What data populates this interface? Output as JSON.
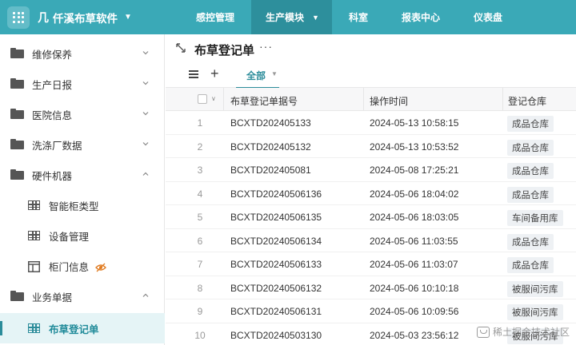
{
  "app": {
    "logo": "几",
    "name": "仟溪布草软件",
    "grid_icon": "apps-grid-icon"
  },
  "nav": {
    "items": [
      {
        "label": "感控管理",
        "active": false
      },
      {
        "label": "生产模块",
        "active": true
      },
      {
        "label": "科室",
        "active": false
      },
      {
        "label": "报表中心",
        "active": false
      },
      {
        "label": "仪表盘",
        "active": false
      }
    ]
  },
  "sidebar": {
    "items": [
      {
        "label": "维修保养",
        "icon": "folder-icon",
        "expanded": false
      },
      {
        "label": "生产日报",
        "icon": "folder-icon",
        "expanded": false
      },
      {
        "label": "医院信息",
        "icon": "folder-icon",
        "expanded": false
      },
      {
        "label": "洗涤厂数据",
        "icon": "folder-icon",
        "expanded": false
      },
      {
        "label": "硬件机器",
        "icon": "folder-icon",
        "expanded": true
      },
      {
        "label": "智能柜类型",
        "icon": "table-icon"
      },
      {
        "label": "设备管理",
        "icon": "table-icon"
      },
      {
        "label": "柜门信息",
        "icon": "cabinet-door-icon",
        "badge_icon": "eye-off-icon"
      },
      {
        "label": "业务单据",
        "icon": "folder-icon",
        "expanded": true
      },
      {
        "label": "布草登记单",
        "icon": "table-icon",
        "active": true
      }
    ]
  },
  "page": {
    "title": "布草登记单",
    "more": "···"
  },
  "toolbar": {
    "tab_all": "全部"
  },
  "table": {
    "columns": [
      "布草登记单据号",
      "操作时间",
      "登记仓库"
    ],
    "rows": [
      {
        "index": "1",
        "code": "BCXTD202405133",
        "time": "2024-05-13 10:58:15",
        "warehouse": "成品仓库"
      },
      {
        "index": "2",
        "code": "BCXTD202405132",
        "time": "2024-05-13 10:53:52",
        "warehouse": "成品仓库"
      },
      {
        "index": "3",
        "code": "BCXTD202405081",
        "time": "2024-05-08 17:25:21",
        "warehouse": "成品仓库"
      },
      {
        "index": "4",
        "code": "BCXTD20240506136",
        "time": "2024-05-06 18:04:02",
        "warehouse": "成品仓库"
      },
      {
        "index": "5",
        "code": "BCXTD20240506135",
        "time": "2024-05-06 18:03:05",
        "warehouse": "车间备用库"
      },
      {
        "index": "6",
        "code": "BCXTD20240506134",
        "time": "2024-05-06 11:03:55",
        "warehouse": "成品仓库"
      },
      {
        "index": "7",
        "code": "BCXTD20240506133",
        "time": "2024-05-06 11:03:07",
        "warehouse": "成品仓库"
      },
      {
        "index": "8",
        "code": "BCXTD20240506132",
        "time": "2024-05-06 10:10:18",
        "warehouse": "被服间污库"
      },
      {
        "index": "9",
        "code": "BCXTD20240506131",
        "time": "2024-05-06 10:09:56",
        "warehouse": "被服间污库"
      },
      {
        "index": "10",
        "code": "BCXTD20240503130",
        "time": "2024-05-03 23:56:12",
        "warehouse": "被服间污库"
      }
    ]
  },
  "watermark": "稀土掘金技术社区",
  "colors": {
    "topbar": "#3aa9b7",
    "nav_active": "#2d8f9c",
    "accent": "#2b8c9a",
    "sidebar_active_bg": "#e5f4f6"
  }
}
